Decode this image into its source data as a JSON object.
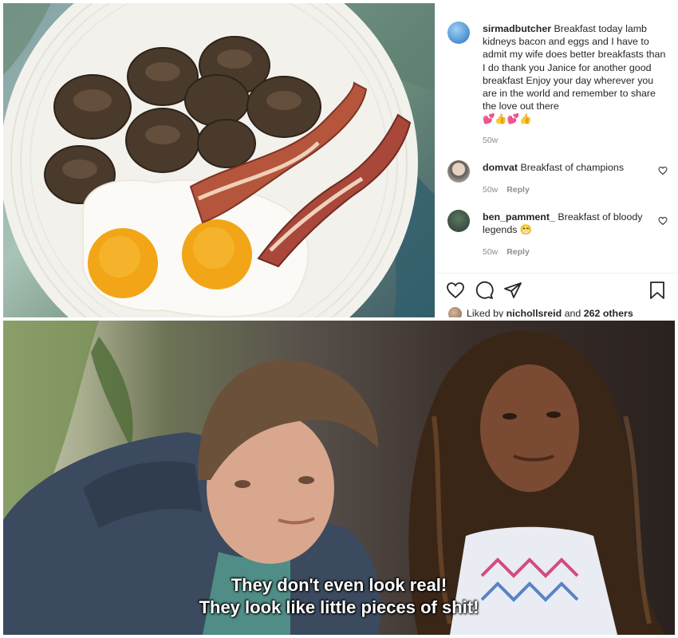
{
  "post": {
    "caption_user": "sirmadbutcher",
    "caption_text": "Breakfast today lamb kidneys bacon and eggs and I have to admit my wife does better breakfasts than I do thank you Janice for another good breakfast Enjoy your day wherever you are in the world and remember to share the love out there",
    "caption_emojis": "💕👍💕👍",
    "caption_time": "50w",
    "comments": [
      {
        "user": "domvat",
        "text": "Breakfast of champions",
        "time": "50w",
        "reply": "Reply"
      },
      {
        "user": "ben_pamment_",
        "text": "Breakfast of bloody legends 😁",
        "time": "50w",
        "reply": "Reply"
      }
    ],
    "liked_prefix": "Liked by",
    "liked_user": "nichollsreid",
    "liked_mid": "and",
    "liked_count": "262 others",
    "icons": [
      "heart-icon",
      "comment-icon",
      "share-icon",
      "bookmark-icon"
    ]
  },
  "still": {
    "subtitle_line1": "They don't even look real!",
    "subtitle_line2": "They look like little pieces of shit!"
  },
  "colors": {
    "text": "#262626",
    "muted": "#8e8e8e",
    "subtitle": "#ffffff"
  }
}
